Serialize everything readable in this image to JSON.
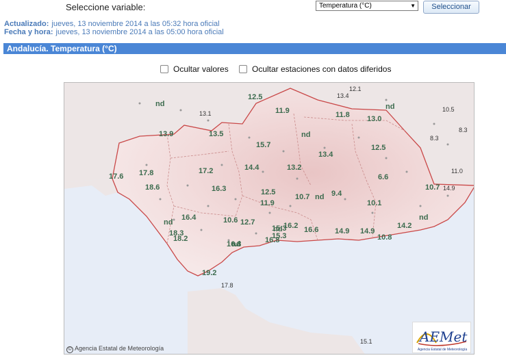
{
  "header": {
    "select_label": "Seleccione variable:",
    "selected_variable": "Temperatura (°C)",
    "button_label": "Seleccionar"
  },
  "meta": {
    "updated_label": "Actualizado:",
    "updated_value": "jueves, 13 noviembre 2014 a las 05:32 hora oficial",
    "date_label": "Fecha y hora:",
    "date_value": "jueves, 13 noviembre 2014 a las 05:00 hora oficial"
  },
  "map_title": "Andalucía. Temperatura (°C)",
  "options": {
    "hide_values": "Ocultar valores",
    "hide_deferred": "Ocultar estaciones con datos diferidos"
  },
  "credit": "Agencia Estatal de Meteorología",
  "logo": {
    "name": "AEMet",
    "subtitle": "Agencia Estatal de Meteorología"
  },
  "colors": {
    "title_bar": "#4a86d6",
    "land": "#f3dddd",
    "sea": "#e8eef8",
    "border": "#c94848",
    "value": "#3c6b4e"
  },
  "stations": [
    {
      "v": "12.5"
    },
    {
      "v": "11.9"
    },
    {
      "v": "13.4"
    },
    {
      "v": "11.8"
    },
    {
      "v": "13.0"
    },
    {
      "v": "12.1"
    },
    {
      "v": "nd"
    },
    {
      "v": "10.5"
    },
    {
      "v": "8.3"
    },
    {
      "v": "8.3"
    },
    {
      "v": "nd"
    },
    {
      "v": "13.1"
    },
    {
      "v": "13.9"
    },
    {
      "v": "13.5"
    },
    {
      "v": "15.7"
    },
    {
      "v": "nd"
    },
    {
      "v": "13.4"
    },
    {
      "v": "12.5"
    },
    {
      "v": "14.4"
    },
    {
      "v": "13.2"
    },
    {
      "v": "17.2"
    },
    {
      "v": "17.6"
    },
    {
      "v": "17.8"
    },
    {
      "v": "18.6"
    },
    {
      "v": "16.3"
    },
    {
      "v": "12.5"
    },
    {
      "v": "10.7"
    },
    {
      "v": "nd"
    },
    {
      "v": "9.4"
    },
    {
      "v": "6.6"
    },
    {
      "v": "11.0"
    },
    {
      "v": "10.7"
    },
    {
      "v": "14.9"
    },
    {
      "v": "11.9"
    },
    {
      "v": "10.1"
    },
    {
      "v": "16.4"
    },
    {
      "v": "10.6"
    },
    {
      "v": "12.7"
    },
    {
      "v": "15.3"
    },
    {
      "v": "16.2"
    },
    {
      "v": "nd"
    },
    {
      "v": "nd"
    },
    {
      "v": "16.6"
    },
    {
      "v": "14.9"
    },
    {
      "v": "14.9"
    },
    {
      "v": "14.2"
    },
    {
      "v": "10.8"
    },
    {
      "v": "nd"
    },
    {
      "v": "18.3"
    },
    {
      "v": "18.2"
    },
    {
      "v": "nd"
    },
    {
      "v": "16.8"
    },
    {
      "v": "15.3"
    },
    {
      "v": "16.8"
    },
    {
      "v": "19.2"
    },
    {
      "v": "17.8"
    },
    {
      "v": "15.1"
    }
  ]
}
